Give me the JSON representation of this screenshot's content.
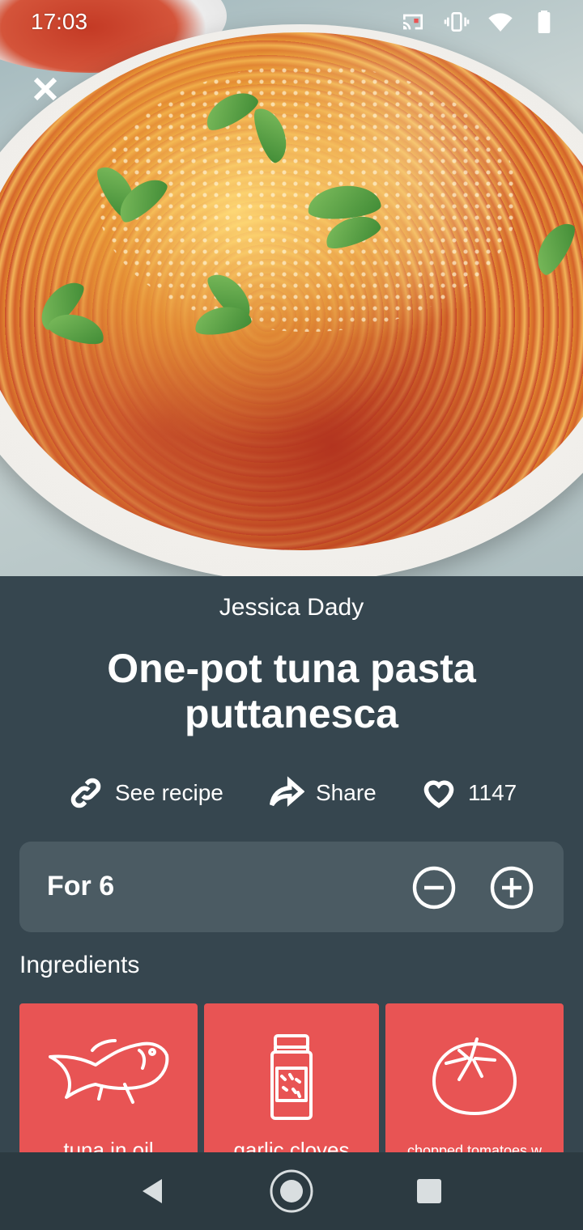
{
  "status_bar": {
    "time": "17:03",
    "icons": [
      "cast-icon",
      "vibrate-icon",
      "wifi-icon",
      "battery-icon"
    ]
  },
  "recipe": {
    "author": "Jessica Dady",
    "title": "One-pot tuna pasta puttanesca"
  },
  "actions": {
    "see_recipe_label": "See recipe",
    "share_label": "Share",
    "likes_count": "1147"
  },
  "servings": {
    "label": "For 6"
  },
  "ingredients": {
    "heading": "Ingredients",
    "items": [
      {
        "name": "tuna in oil",
        "icon": "fish-icon"
      },
      {
        "name": "garlic cloves",
        "icon": "spice-jar-icon"
      },
      {
        "name": "chopped tomatoes w",
        "icon": "tomato-icon"
      }
    ]
  },
  "colors": {
    "background": "#36464f",
    "panel": "#4b5b63",
    "ingredient_tile": "#e85454",
    "nav_bar": "#2c3a41"
  }
}
